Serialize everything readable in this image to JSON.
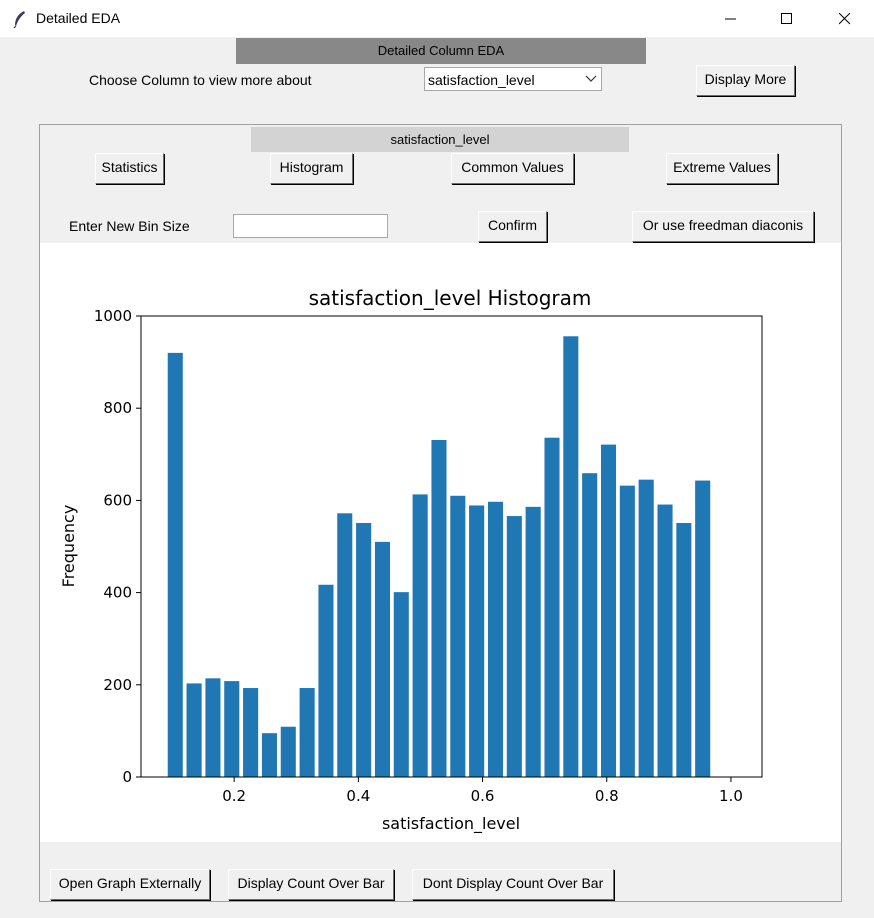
{
  "window": {
    "title": "Detailed EDA"
  },
  "header": {
    "title": "Detailed Column EDA"
  },
  "chooser": {
    "label": "Choose Column to view more about",
    "selected": "satisfaction_level",
    "display_more": "Display More"
  },
  "panel": {
    "column_label": "satisfaction_level",
    "buttons": {
      "statistics": "Statistics",
      "histogram": "Histogram",
      "common_values": "Common Values",
      "extreme_values": "Extreme Values"
    },
    "bin": {
      "label": "Enter New Bin Size",
      "value": "",
      "confirm": "Confirm",
      "freedman": "Or use freedman diaconis"
    }
  },
  "footer": {
    "open_external": "Open Graph Externally",
    "display_count": "Display Count Over Bar",
    "dont_display_count": "Dont Display Count Over Bar"
  },
  "chart_data": {
    "type": "bar",
    "title": "satisfaction_level Histogram",
    "xlabel": "satisfaction_level",
    "ylabel": "Frequency",
    "xlim": [
      0.05,
      1.05
    ],
    "ylim": [
      0,
      1000
    ],
    "xticks": [
      0.2,
      0.4,
      0.6,
      0.8,
      1.0
    ],
    "xtick_labels": [
      "0.2",
      "0.4",
      "0.6",
      "0.8",
      "1.0"
    ],
    "yticks": [
      0,
      200,
      400,
      600,
      800,
      1000
    ],
    "ytick_labels": [
      "0",
      "200",
      "400",
      "600",
      "800",
      "1000"
    ],
    "bar_color": "#1f77b4",
    "bins": [
      {
        "start": 0.09,
        "end": 0.1203,
        "value": 920
      },
      {
        "start": 0.1203,
        "end": 0.1507,
        "value": 203
      },
      {
        "start": 0.1507,
        "end": 0.181,
        "value": 214
      },
      {
        "start": 0.181,
        "end": 0.2113,
        "value": 208
      },
      {
        "start": 0.2113,
        "end": 0.2417,
        "value": 193
      },
      {
        "start": 0.2417,
        "end": 0.272,
        "value": 95
      },
      {
        "start": 0.272,
        "end": 0.3023,
        "value": 109
      },
      {
        "start": 0.3023,
        "end": 0.3327,
        "value": 193
      },
      {
        "start": 0.3327,
        "end": 0.363,
        "value": 417
      },
      {
        "start": 0.363,
        "end": 0.3933,
        "value": 572
      },
      {
        "start": 0.3933,
        "end": 0.4237,
        "value": 551
      },
      {
        "start": 0.4237,
        "end": 0.454,
        "value": 510
      },
      {
        "start": 0.454,
        "end": 0.4843,
        "value": 401
      },
      {
        "start": 0.4843,
        "end": 0.5147,
        "value": 613
      },
      {
        "start": 0.5147,
        "end": 0.545,
        "value": 731
      },
      {
        "start": 0.545,
        "end": 0.5753,
        "value": 610
      },
      {
        "start": 0.5753,
        "end": 0.6057,
        "value": 589
      },
      {
        "start": 0.6057,
        "end": 0.636,
        "value": 597
      },
      {
        "start": 0.636,
        "end": 0.6663,
        "value": 566
      },
      {
        "start": 0.6663,
        "end": 0.6967,
        "value": 586
      },
      {
        "start": 0.6967,
        "end": 0.727,
        "value": 736
      },
      {
        "start": 0.727,
        "end": 0.7573,
        "value": 956
      },
      {
        "start": 0.7573,
        "end": 0.7877,
        "value": 659
      },
      {
        "start": 0.7877,
        "end": 0.818,
        "value": 721
      },
      {
        "start": 0.818,
        "end": 0.8483,
        "value": 632
      },
      {
        "start": 0.8483,
        "end": 0.8787,
        "value": 645
      },
      {
        "start": 0.8787,
        "end": 0.909,
        "value": 591
      },
      {
        "start": 0.909,
        "end": 0.9393,
        "value": 551
      },
      {
        "start": 0.9393,
        "end": 0.9697,
        "value": 643
      }
    ]
  }
}
